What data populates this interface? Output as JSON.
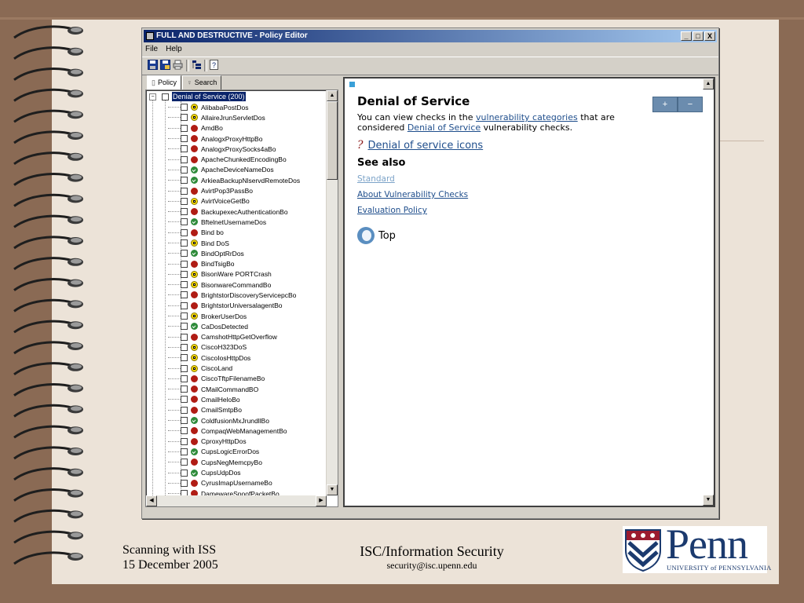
{
  "window": {
    "title": "FULL AND DESTRUCTIVE - Policy Editor",
    "controls": [
      "_",
      "□",
      "X"
    ]
  },
  "menu": [
    "File",
    "Help"
  ],
  "toolbar_icons": [
    "save-icon",
    "save-as-icon",
    "print-icon",
    "tree-view-icon",
    "help-icon"
  ],
  "tabs": [
    {
      "label": "Policy",
      "icon": "page-icon",
      "active": true
    },
    {
      "label": "Search",
      "icon": "search-icon",
      "active": false
    }
  ],
  "tree": {
    "root_label": "Denial of Service (200)",
    "items": [
      {
        "label": "AlibabaPostDos",
        "severity": "yellow"
      },
      {
        "label": "AllaireJrunServletDos",
        "severity": "yellow"
      },
      {
        "label": "AmdBo",
        "severity": "red"
      },
      {
        "label": "AnalogxProxyHttpBo",
        "severity": "red"
      },
      {
        "label": "AnalogxProxySocks4aBo",
        "severity": "red"
      },
      {
        "label": "ApacheChunkedEncodingBo",
        "severity": "red"
      },
      {
        "label": "ApacheDeviceNameDos",
        "severity": "green"
      },
      {
        "label": "ArkieaBackupNlservdRemoteDos",
        "severity": "green"
      },
      {
        "label": "AvirtPop3PassBo",
        "severity": "red"
      },
      {
        "label": "AvirtVoiceGetBo",
        "severity": "yellow"
      },
      {
        "label": "BackupexecAuthenticationBo",
        "severity": "red"
      },
      {
        "label": "BftelnetUsernameDos",
        "severity": "green"
      },
      {
        "label": "Bind bo",
        "severity": "red"
      },
      {
        "label": "Bind DoS",
        "severity": "yellow"
      },
      {
        "label": "BindOptRrDos",
        "severity": "green"
      },
      {
        "label": "BindTsigBo",
        "severity": "red"
      },
      {
        "label": "BisonWare PORTCrash",
        "severity": "yellow"
      },
      {
        "label": "BisonwareCommandBo",
        "severity": "yellow"
      },
      {
        "label": "BrightstorDiscoveryServicepcBo",
        "severity": "red"
      },
      {
        "label": "BrightstorUniversalagentBo",
        "severity": "red"
      },
      {
        "label": "BrokerUserDos",
        "severity": "yellow"
      },
      {
        "label": "CaDosDetected",
        "severity": "green"
      },
      {
        "label": "CamshotHttpGetOverflow",
        "severity": "red"
      },
      {
        "label": "CiscoH323DoS",
        "severity": "yellow"
      },
      {
        "label": "CiscoIosHttpDos",
        "severity": "yellow"
      },
      {
        "label": "CiscoLand",
        "severity": "yellow"
      },
      {
        "label": "CiscoTftpFilenameBo",
        "severity": "red"
      },
      {
        "label": "CMailCommandBO",
        "severity": "red"
      },
      {
        "label": "CmailHeloBo",
        "severity": "red"
      },
      {
        "label": "CmailSmtpBo",
        "severity": "red"
      },
      {
        "label": "ColdfusionMxJrundllBo",
        "severity": "green"
      },
      {
        "label": "CompaqWebManagementBo",
        "severity": "red"
      },
      {
        "label": "CproxyHttpDos",
        "severity": "red"
      },
      {
        "label": "CupsLogicErrorDos",
        "severity": "green"
      },
      {
        "label": "CupsNegMemcpyBo",
        "severity": "red"
      },
      {
        "label": "CupsUdpDos",
        "severity": "green"
      },
      {
        "label": "CyrusImapUsernameBo",
        "severity": "red"
      },
      {
        "label": "DamewareSpoofPacketBo",
        "severity": "red"
      }
    ]
  },
  "help": {
    "heading": "Denial of Service",
    "plus": "+",
    "minus": "−",
    "para_prefix": "You can view checks in the ",
    "link_categories": "vulnerability categories",
    "para_middle": " that are considered ",
    "link_dos": "Denial of Service",
    "para_suffix": " vulnerability checks.",
    "icons_link": "Denial of service icons",
    "icons_glyph": "?",
    "see_also": "See also",
    "see_also_links": [
      "Standard",
      "About Vulnerability Checks",
      "Evaluation Policy"
    ],
    "top_label": "Top"
  },
  "footer": {
    "left_line1": "Scanning with ISS",
    "left_line2": "15 December 2005",
    "mid_line1": "ISC/Information Security",
    "mid_line2": "security@isc.upenn.edu",
    "logo_word": "Penn",
    "logo_sub": "UNIVERSITY of PENNSYLVANIA"
  },
  "colors": {
    "titlebar": "#0a246a",
    "link": "#1f4e8c",
    "penn_blue": "#1b3a6e",
    "severity_high": "#b01c14",
    "severity_medium": "#f2d60a",
    "severity_low": "#2e8b3a"
  }
}
